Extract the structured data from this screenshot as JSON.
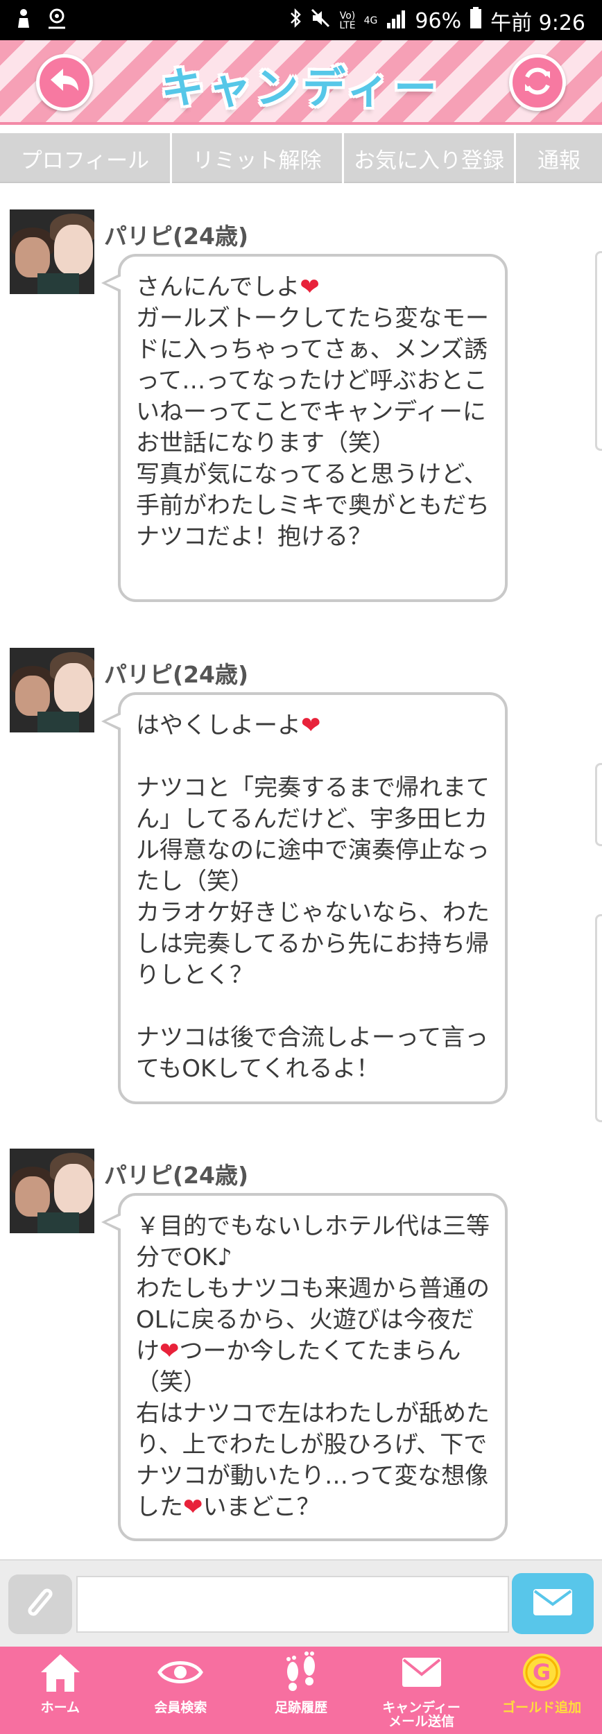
{
  "status_bar": {
    "battery_percent": "96%",
    "time": "午前 9:26",
    "lte_label": "Vo)\nLTE",
    "network": "4G"
  },
  "header": {
    "title": "キャンディー",
    "back_icon": "back-arrow-icon",
    "refresh_icon": "refresh-icon"
  },
  "tabs": [
    {
      "label": "プロフィール"
    },
    {
      "label": "リミット解除"
    },
    {
      "label": "お気に入り登録"
    },
    {
      "label": "通報"
    }
  ],
  "messages": [
    {
      "name": "パリピ(24歳)",
      "text": "さんにんでしよ❤\nガールズトークしてたら変なモードに入っちゃってさぁ、メンズ誘って…ってなったけど呼ぶおとこいねーってことでキャンディーにお世話になります（笑）\n写真が気になってると思うけど、手前がわたしミキで奥がともだちナツコだよ！抱ける？"
    },
    {
      "name": "パリピ(24歳)",
      "text": "はやくしよーよ❤\n\nナツコと「完奏するまで帰れまてん」してるんだけど、宇多田ヒカル得意なのに途中で演奏停止なったし（笑）\nカラオケ好きじゃないなら、わたしは完奏してるから先にお持ち帰りしとく？\n\nナツコは後で合流しよーって言ってもOKしてくれるよ！"
    },
    {
      "name": "パリピ(24歳)",
      "text": "￥目的でもないしホテル代は三等分でOK♪\nわたしもナツコも来週から普通のOLに戻るから、火遊びは今夜だけ❤つーか今したくてたまらん（笑）\n右はナツコで左はわたしが舐めたり、上でわたしが股ひろげ、下でナツコが動いたり…って変な想像した❤いまどこ？"
    }
  ],
  "input": {
    "placeholder": "",
    "attach_icon": "paperclip-icon",
    "send_icon": "envelope-icon"
  },
  "bottom_nav": [
    {
      "label": "ホーム",
      "icon": "home-icon"
    },
    {
      "label": "会員検索",
      "icon": "eye-icon"
    },
    {
      "label": "足跡履歴",
      "icon": "footprints-icon"
    },
    {
      "label": "キャンディー\nメール送信",
      "icon": "mail-icon"
    },
    {
      "label": "ゴールド追加",
      "icon": "gold-coin-icon"
    }
  ],
  "colors": {
    "header_pink": "#f6a0b6",
    "title_blue": "#56c7e8",
    "nav_pink": "#f76fa0",
    "send_blue": "#58c6ea",
    "gold": "#ffde3b",
    "heart_red": "#e8223a"
  }
}
